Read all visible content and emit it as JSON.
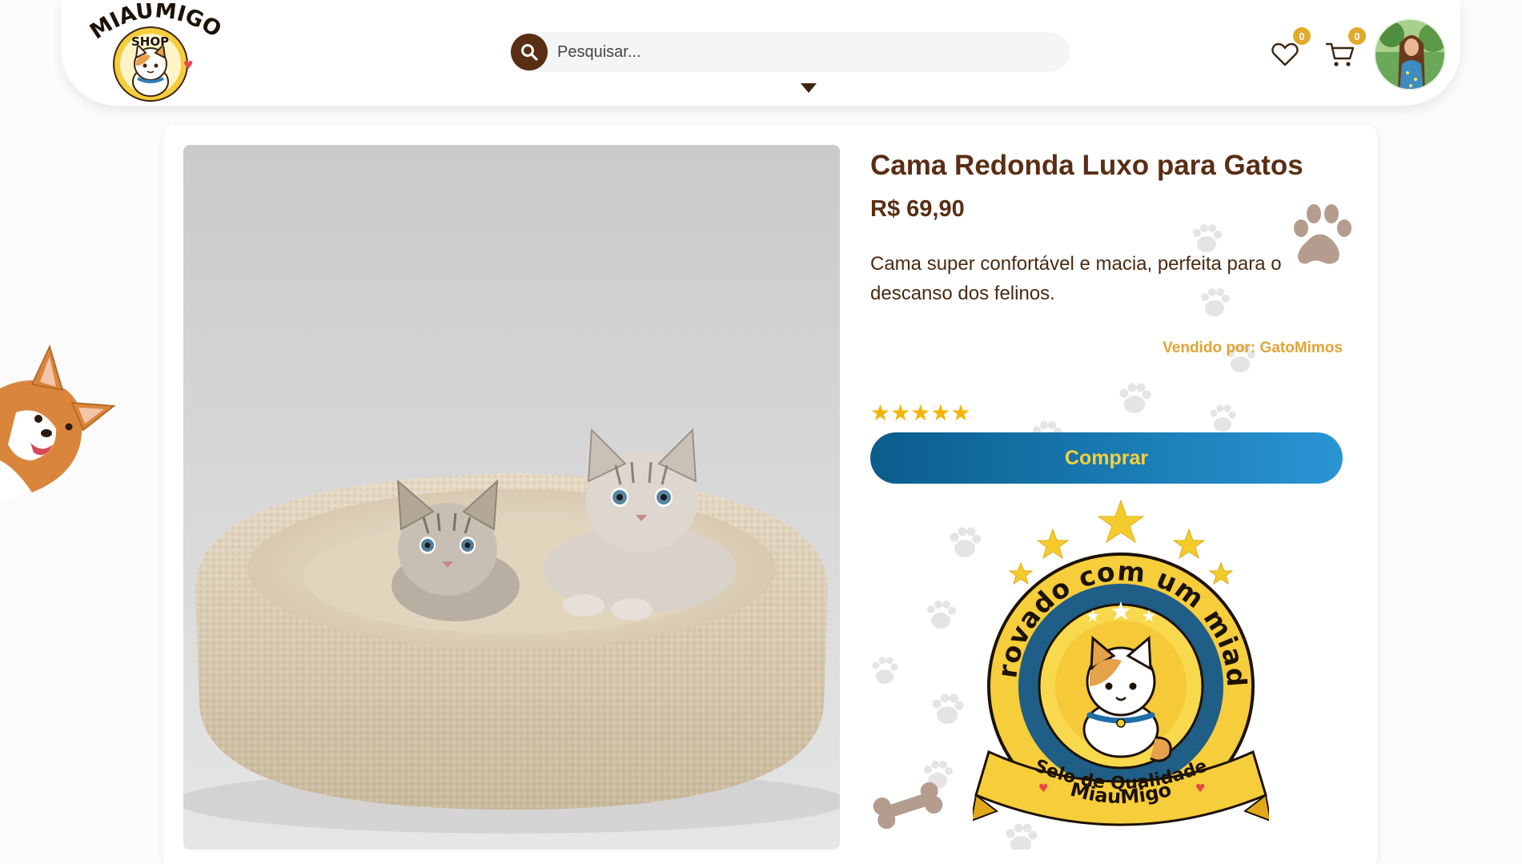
{
  "header": {
    "logo": {
      "text_top": "MIAUMIGO",
      "text_bottom": "SHOP",
      "icon": "cat-logo-icon"
    },
    "search": {
      "placeholder": "Pesquisar...",
      "value": "",
      "icon": "search-icon"
    },
    "dropdown_icon": "caret-down-icon",
    "wishlist": {
      "icon": "heart-icon",
      "count": "0"
    },
    "cart": {
      "icon": "cart-icon",
      "count": "0"
    },
    "avatar": {
      "icon": "user-avatar"
    }
  },
  "product": {
    "title": "Cama Redonda Luxo para Gatos",
    "price": "R$ 69,90",
    "description": "Cama super confortável e macia, perfeita para o descanso dos felinos.",
    "seller_label": "Vendido por:",
    "seller_name": "GatoMimos",
    "rating": 5,
    "rating_stars": "★★★★★",
    "buy_label": "Comprar",
    "image_icon": "cat-bed-kittens-photo"
  },
  "seal": {
    "arc_text": "Aprovado com um miado!",
    "ribbon_line1": "Selo de Qualidade",
    "ribbon_line2": "MiauMigo"
  },
  "colors": {
    "brand_brown": "#5a2e14",
    "accent_gold": "#e0a437",
    "button_blue": "#1a7cb4",
    "button_text": "#f5d040",
    "star": "#f5b400"
  }
}
